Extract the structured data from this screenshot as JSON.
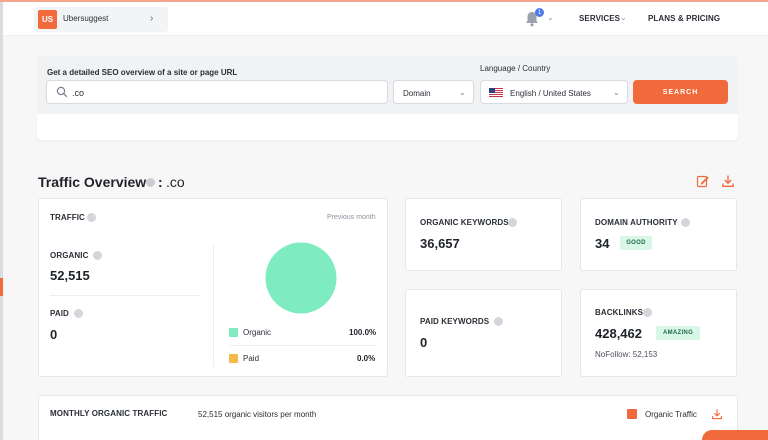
{
  "topbar": {
    "logo_text": "US",
    "project_name": "Ubersuggest",
    "chevron": "›",
    "bell_badge": "1",
    "dropdown_glyph": "⌄",
    "nav": {
      "services": "SERVICES",
      "plans": "PLANS & PRICING"
    }
  },
  "search": {
    "label": "Get a detailed SEO overview of a site or page URL",
    "domain_value": ".co",
    "type_value": "Domain",
    "language_label": "Language / Country",
    "language_value": "English / United States",
    "button": "SEARCH"
  },
  "overview": {
    "title": "Traffic Overview",
    "colon": ":",
    "domain": ".co"
  },
  "traffic": {
    "label": "TRAFFIC",
    "period": "Previous month",
    "organic_label": "ORGANIC",
    "organic_value": "52,515",
    "paid_label": "PAID",
    "paid_value": "0",
    "legend": [
      {
        "label": "Organic",
        "pct": "100.0%",
        "share": 1.0
      },
      {
        "label": "Paid",
        "pct": "0.0%",
        "share": 0.0
      }
    ]
  },
  "metrics": {
    "organic_keywords_label": "ORGANIC KEYWORDS",
    "organic_keywords_value": "36,657",
    "domain_authority_label": "DOMAIN AUTHORITY",
    "domain_authority_value": "34",
    "domain_authority_badge": "GOOD",
    "paid_keywords_label": "PAID KEYWORDS",
    "paid_keywords_value": "0",
    "backlinks_label": "BACKLINKS",
    "backlinks_value": "428,462",
    "backlinks_badge": "AMAZING",
    "nofollow": "NoFollow: 52,153"
  },
  "monthly": {
    "title": "MONTHLY ORGANIC TRAFFIC",
    "subtitle": "52,515 organic visitors per month",
    "legend": "Organic Traffic"
  },
  "colors": {
    "accent": "#f06a3b",
    "organic": "#7eebc0",
    "paid": "#f5b94a",
    "good_badge": "#d9f7e6",
    "info_blue": "#4c7be8"
  },
  "icons": [
    "search-icon",
    "bell-icon",
    "chevron-down-icon",
    "flag-us-icon",
    "edit-icon",
    "download-icon",
    "info-icon"
  ]
}
